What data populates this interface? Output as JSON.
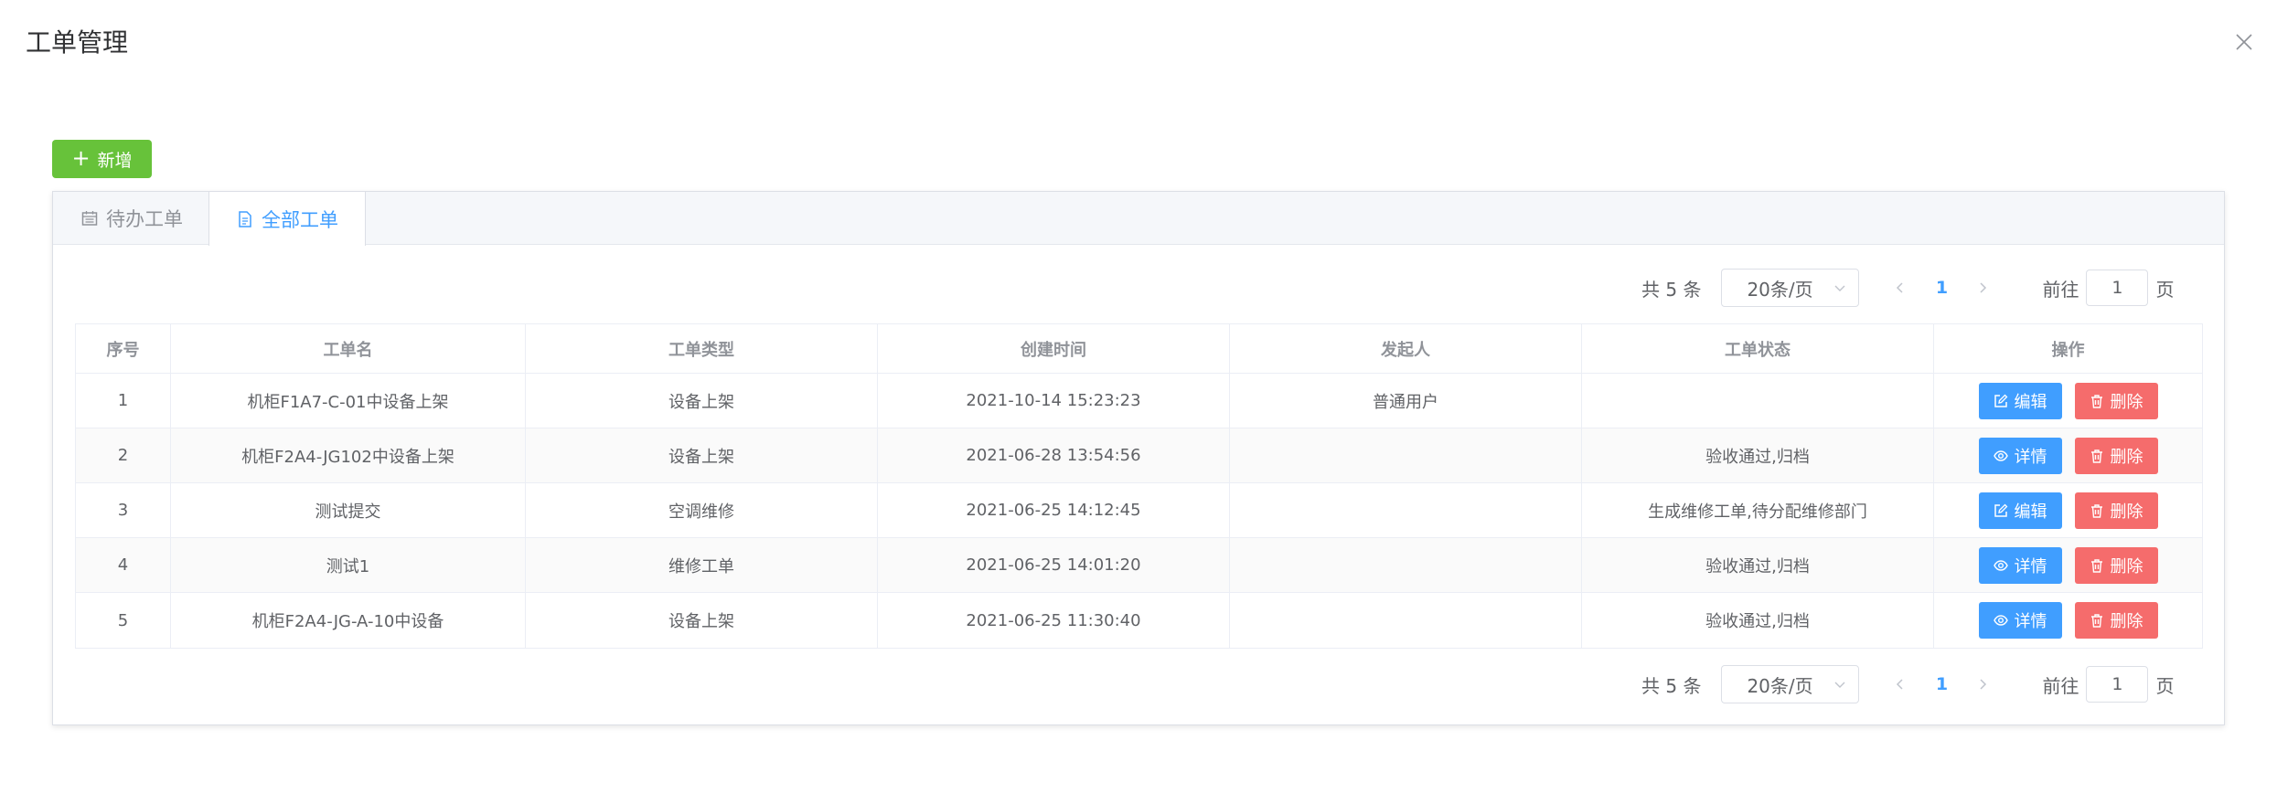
{
  "dialog": {
    "title": "工单管理"
  },
  "toolbar": {
    "add_label": "新增"
  },
  "tabs": [
    {
      "label": "待办工单",
      "icon": "calendar-icon",
      "active": false
    },
    {
      "label": "全部工单",
      "icon": "document-icon",
      "active": true
    }
  ],
  "pagination": {
    "total_text": "共 5 条",
    "page_size": "20条/页",
    "current_page": "1",
    "goto_prefix": "前往",
    "goto_value": "1",
    "goto_suffix": "页"
  },
  "table": {
    "columns": [
      "序号",
      "工单名",
      "工单类型",
      "创建时间",
      "发起人",
      "工单状态",
      "操作"
    ],
    "rows": [
      {
        "index": "1",
        "name": "机柜F1A7-C-01中设备上架",
        "type": "设备上架",
        "created": "2021-10-14 15:23:23",
        "initiator": "普通用户",
        "status": "",
        "primary_action": "编辑",
        "primary_icon": "edit-icon",
        "delete_action": "删除"
      },
      {
        "index": "2",
        "name": "机柜F2A4-JG102中设备上架",
        "type": "设备上架",
        "created": "2021-06-28 13:54:56",
        "initiator": "",
        "status": "验收通过,归档",
        "primary_action": "详情",
        "primary_icon": "eye-icon",
        "delete_action": "删除"
      },
      {
        "index": "3",
        "name": "测试提交",
        "type": "空调维修",
        "created": "2021-06-25 14:12:45",
        "initiator": "",
        "status": "生成维修工单,待分配维修部门",
        "primary_action": "编辑",
        "primary_icon": "edit-icon",
        "delete_action": "删除"
      },
      {
        "index": "4",
        "name": "测试1",
        "type": "维修工单",
        "created": "2021-06-25 14:01:20",
        "initiator": "",
        "status": "验收通过,归档",
        "primary_action": "详情",
        "primary_icon": "eye-icon",
        "delete_action": "删除"
      },
      {
        "index": "5",
        "name": "机柜F2A4-JG-A-10中设备",
        "type": "设备上架",
        "created": "2021-06-25 11:30:40",
        "initiator": "",
        "status": "验收通过,归档",
        "primary_action": "详情",
        "primary_icon": "eye-icon",
        "delete_action": "删除"
      }
    ]
  },
  "colors": {
    "primary": "#409eff",
    "success": "#67c23a",
    "danger": "#f56c6c"
  }
}
